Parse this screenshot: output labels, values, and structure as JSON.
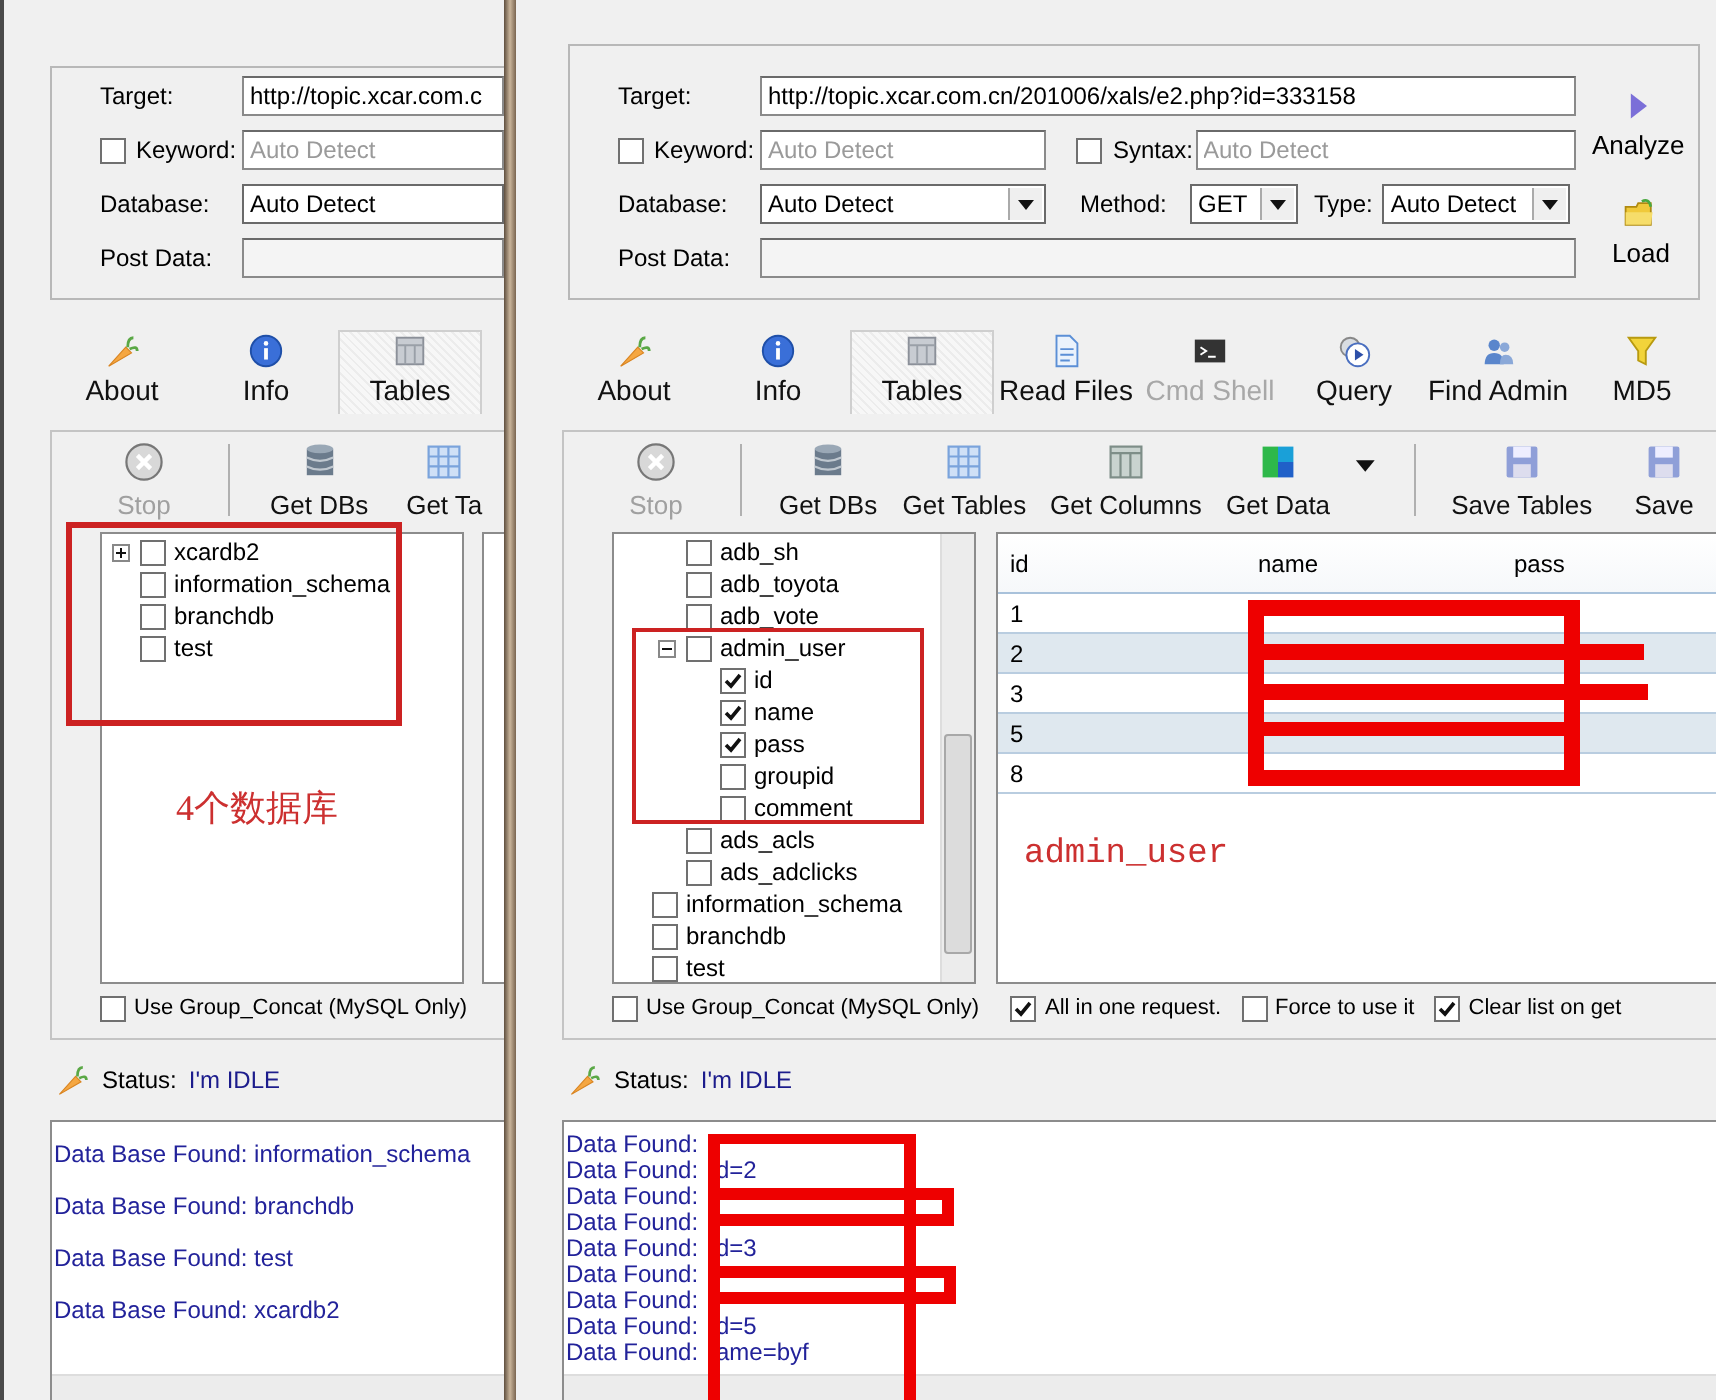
{
  "left_window": {
    "target": {
      "label": "Target:",
      "value": "http://topic.xcar.com.c"
    },
    "keyword": {
      "label": "Keyword:",
      "checked": false,
      "placeholder": "Auto Detect"
    },
    "database": {
      "label": "Database:",
      "value": "Auto Detect"
    },
    "post_data": {
      "label": "Post Data:"
    },
    "tabs": [
      {
        "label": "About",
        "selected": false,
        "disabled": false
      },
      {
        "label": "Info",
        "selected": false,
        "disabled": false
      },
      {
        "label": "Tables",
        "selected": true,
        "disabled": false
      }
    ],
    "toolbar": [
      {
        "label": "Stop",
        "disabled": true
      },
      {
        "label": "Get DBs",
        "disabled": false
      },
      {
        "label": "Get Ta",
        "disabled": false
      }
    ],
    "tree": [
      {
        "label": "xcardb2",
        "checked": false,
        "expanded": false
      },
      {
        "label": "information_schema",
        "checked": false
      },
      {
        "label": "branchdb",
        "checked": false
      },
      {
        "label": "test",
        "checked": false
      }
    ],
    "options": [
      {
        "label": "Use Group_Concat (MySQL Only)",
        "checked": false
      }
    ],
    "status": {
      "label": "Status:",
      "value": "I'm IDLE"
    },
    "log": [
      "Data Base Found: information_schema",
      "Data Base Found: branchdb",
      "Data Base Found: test",
      "Data Base Found: xcardb2"
    ]
  },
  "right_window": {
    "target": {
      "label": "Target:",
      "value": "http://topic.xcar.com.cn/201006/xals/e2.php?id=333158"
    },
    "keyword": {
      "label": "Keyword:",
      "checked": false,
      "placeholder": "Auto Detect"
    },
    "syntax": {
      "label": "Syntax:",
      "checked": false,
      "placeholder": "Auto Detect"
    },
    "database": {
      "label": "Database:",
      "value": "Auto Detect"
    },
    "method": {
      "label": "Method:",
      "value": "GET"
    },
    "type": {
      "label": "Type:",
      "value": "Auto Detect"
    },
    "post_data": {
      "label": "Post Data:"
    },
    "side_buttons": [
      "Analyze",
      "Load"
    ],
    "tabs": [
      {
        "label": "About",
        "selected": false,
        "disabled": false
      },
      {
        "label": "Info",
        "selected": false,
        "disabled": false
      },
      {
        "label": "Tables",
        "selected": true,
        "disabled": false
      },
      {
        "label": "Read Files",
        "selected": false,
        "disabled": false
      },
      {
        "label": "Cmd Shell",
        "selected": false,
        "disabled": true
      },
      {
        "label": "Query",
        "selected": false,
        "disabled": false
      },
      {
        "label": "Find Admin",
        "selected": false,
        "disabled": false
      },
      {
        "label": "MD5",
        "selected": false,
        "disabled": false
      }
    ],
    "toolbar": [
      {
        "label": "Stop",
        "disabled": true
      },
      {
        "label": "Get DBs",
        "disabled": false
      },
      {
        "label": "Get Tables",
        "disabled": false
      },
      {
        "label": "Get Columns",
        "disabled": false
      },
      {
        "label": "Get Data",
        "disabled": false
      },
      {
        "label": "Save Tables",
        "disabled": false
      },
      {
        "label": "Save",
        "disabled": false
      }
    ],
    "tree": {
      "open_database_tables": [
        {
          "label": "adb_sh",
          "checked": false
        },
        {
          "label": "adb_toyota",
          "checked": false
        },
        {
          "label": "adb_vote",
          "checked": false
        },
        {
          "label": "admin_user",
          "checked": false,
          "expanded": true,
          "children": [
            {
              "label": "id",
              "checked": true
            },
            {
              "label": "name",
              "checked": true
            },
            {
              "label": "pass",
              "checked": true
            },
            {
              "label": "groupid",
              "checked": false
            },
            {
              "label": "comment",
              "checked": false
            }
          ]
        },
        {
          "label": "ads_acls",
          "checked": false
        },
        {
          "label": "ads_adclicks",
          "checked": false
        }
      ],
      "databases": [
        {
          "label": "information_schema",
          "checked": false
        },
        {
          "label": "branchdb",
          "checked": false
        },
        {
          "label": "test",
          "checked": false
        }
      ]
    },
    "results": {
      "columns": [
        "id",
        "name",
        "pass"
      ],
      "rows": [
        "1",
        "2",
        "3",
        "5",
        "8"
      ]
    },
    "options": [
      {
        "label": "Use Group_Concat (MySQL Only)",
        "checked": false
      },
      {
        "label": "All in one request.",
        "checked": true
      },
      {
        "label": "Force to use it",
        "checked": false
      },
      {
        "label": "Clear list on get",
        "checked": true
      }
    ],
    "status": {
      "label": "Status:",
      "value": "I'm IDLE"
    },
    "log": [
      {
        "prefix": "Data Found:"
      },
      {
        "prefix": "Data Found:",
        "value": "d=2"
      },
      {
        "prefix": "Data Found:"
      },
      {
        "prefix": "Data Found:"
      },
      {
        "prefix": "Data Found:",
        "value": "d=3"
      },
      {
        "prefix": "Data Found:"
      },
      {
        "prefix": "Data Found:"
      },
      {
        "prefix": "Data Found:",
        "value": "d=5"
      },
      {
        "prefix": "Data Found:",
        "value": "ame=byf"
      }
    ]
  },
  "annotations": {
    "database_count_note": "4个数据库",
    "table_note": "admin_user"
  }
}
